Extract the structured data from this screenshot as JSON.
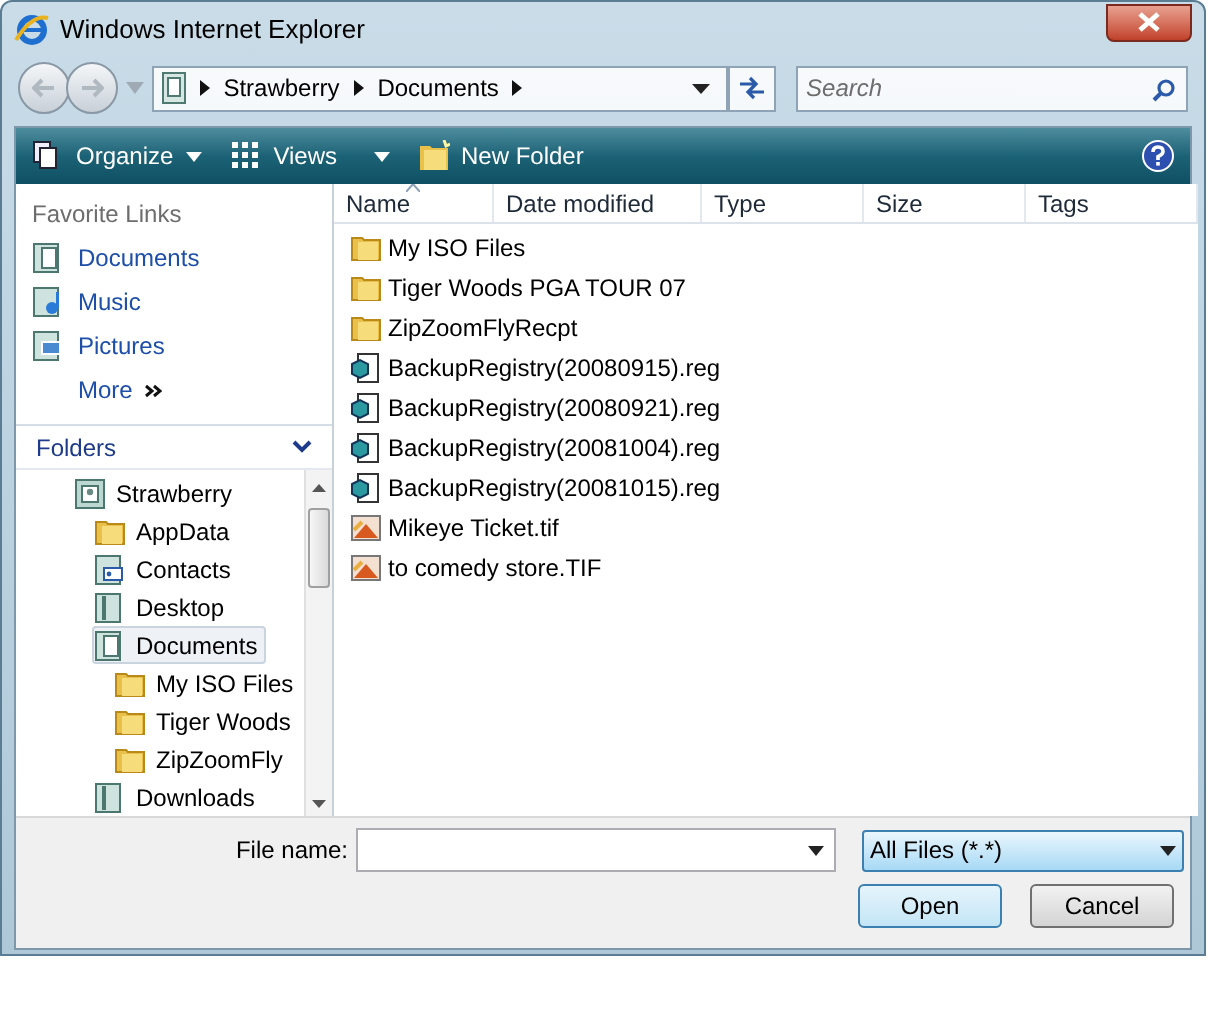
{
  "window": {
    "title": "Windows Internet Explorer"
  },
  "address": {
    "crumbs": [
      "Strawberry",
      "Documents"
    ]
  },
  "search": {
    "placeholder": "Search"
  },
  "toolbar": [
    {
      "label": "Organize",
      "kind": "organize"
    },
    {
      "label": "Views",
      "kind": "views"
    },
    {
      "label": "New Folder",
      "kind": "newfolder"
    }
  ],
  "favorite_links": {
    "title": "Favorite Links",
    "items": [
      {
        "label": "Documents",
        "kind": "documents"
      },
      {
        "label": "Music",
        "kind": "music"
      },
      {
        "label": "Pictures",
        "kind": "pictures"
      }
    ],
    "more": "More"
  },
  "folders": {
    "title": "Folders",
    "tree": [
      {
        "label": "Strawberry",
        "kind": "user",
        "selected": false,
        "children": [
          {
            "label": "AppData",
            "kind": "folder",
            "selected": false
          },
          {
            "label": "Contacts",
            "kind": "contacts",
            "selected": false
          },
          {
            "label": "Desktop",
            "kind": "library",
            "selected": false
          },
          {
            "label": "Documents",
            "kind": "documents",
            "selected": true,
            "children": [
              {
                "label": "My ISO Files",
                "kind": "folder",
                "selected": false
              },
              {
                "label": "Tiger Woods",
                "kind": "folder",
                "selected": false
              },
              {
                "label": "ZipZoomFly",
                "kind": "folder",
                "selected": false
              }
            ]
          },
          {
            "label": "Downloads",
            "kind": "library",
            "selected": false
          }
        ]
      }
    ]
  },
  "table": {
    "columns": [
      {
        "label": "Name",
        "sorted": true
      },
      {
        "label": "Date modified",
        "sorted": false
      },
      {
        "label": "Type",
        "sorted": false
      },
      {
        "label": "Size",
        "sorted": false
      },
      {
        "label": "Tags",
        "sorted": false
      }
    ],
    "rows": [
      {
        "name": "My ISO Files",
        "kind": "folder"
      },
      {
        "name": "Tiger Woods PGA TOUR 07",
        "kind": "folder"
      },
      {
        "name": "ZipZoomFlyRecpt",
        "kind": "folder"
      },
      {
        "name": "BackupRegistry(20080915).reg",
        "kind": "reg"
      },
      {
        "name": "BackupRegistry(20080921).reg",
        "kind": "reg"
      },
      {
        "name": "BackupRegistry(20081004).reg",
        "kind": "reg"
      },
      {
        "name": "BackupRegistry(20081015).reg",
        "kind": "reg"
      },
      {
        "name": "Mikeye Ticket.tif",
        "kind": "image"
      },
      {
        "name": "to comedy store.TIF",
        "kind": "image"
      }
    ]
  },
  "file_name": {
    "label": "File name:"
  },
  "file_type": {
    "value": "All Files (*.*)"
  },
  "buttons": [
    {
      "label": "Open",
      "kind": "default"
    },
    {
      "label": "Cancel",
      "kind": "normal"
    }
  ]
}
